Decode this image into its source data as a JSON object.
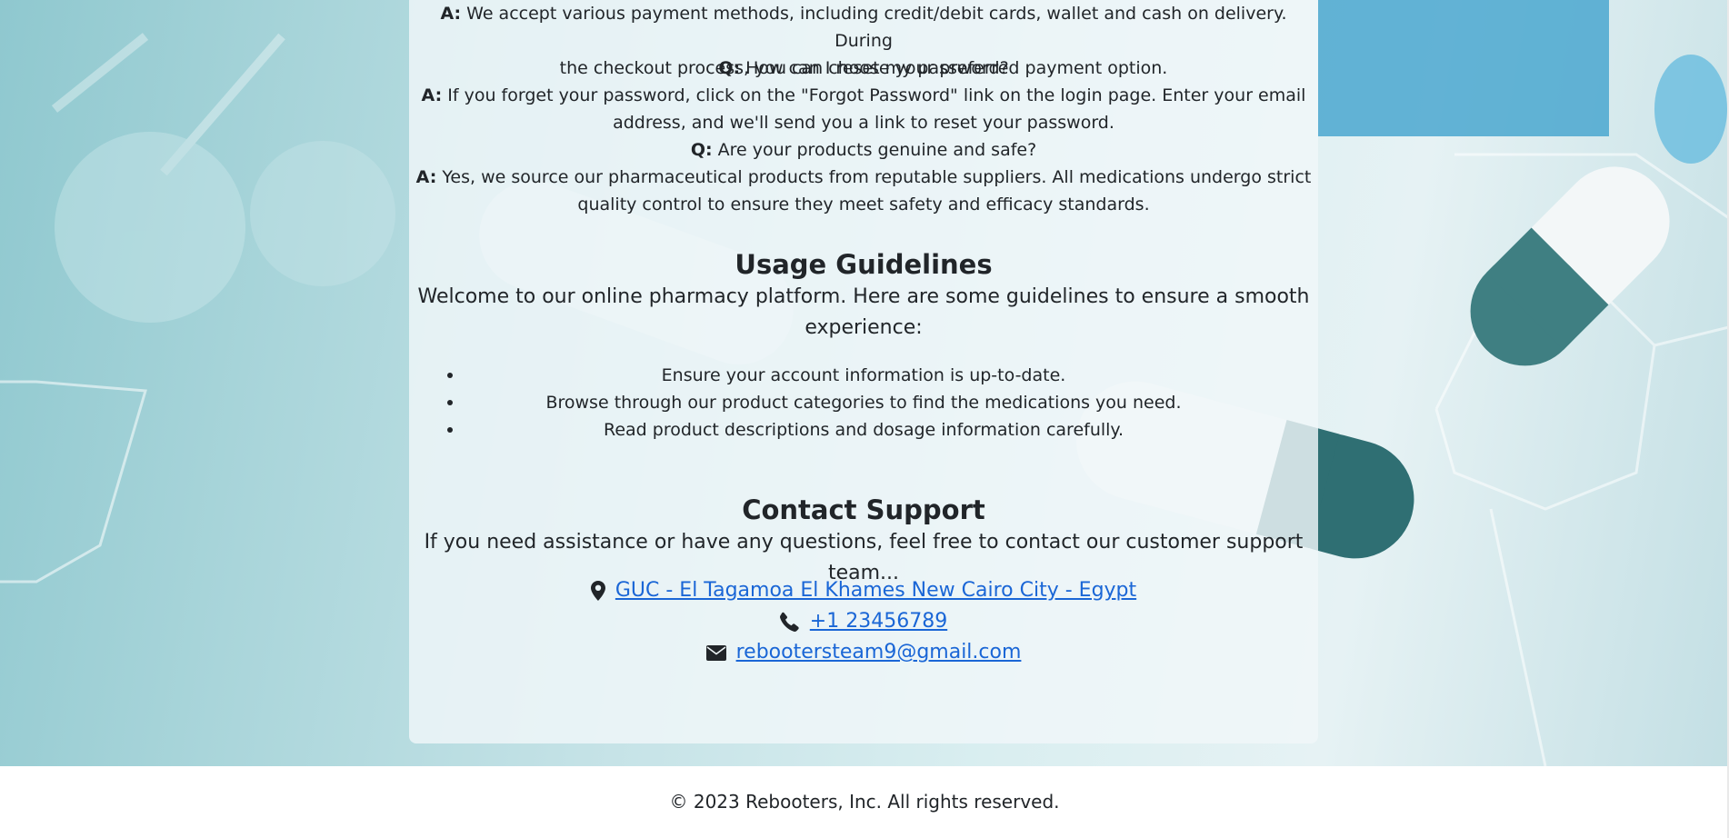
{
  "faq": {
    "a1_prefix": "A:",
    "a1_line1": "We accept various payment methods, including credit/debit cards, wallet and cash on delivery. During",
    "a1_line2": "the checkout process, you can choose your preferred payment option.",
    "q2_prefix": "Q:",
    "q2": "How can I reset my password?",
    "a2_prefix": "A:",
    "a2_line1": "If you forget your password, click on the \"Forgot Password\" link on the login page. Enter your email",
    "a2_line2": "address, and we'll send you a link to reset your password.",
    "q3_prefix": "Q:",
    "q3": "Are your products genuine and safe?",
    "a3_prefix": "A:",
    "a3_line1": "Yes, we source our pharmaceutical products from reputable suppliers. All medications undergo strict",
    "a3_line2": "quality control to ensure they meet safety and efficacy standards."
  },
  "guidelines": {
    "title": "Usage Guidelines",
    "intro_line1": "Welcome to our online pharmacy platform. Here are some guidelines to ensure a smooth",
    "intro_line2": "experience:",
    "items": [
      "Ensure your account information is up-to-date.",
      "Browse through our product categories to find the medications you need.",
      "Read product descriptions and dosage information carefully."
    ]
  },
  "contact": {
    "title": "Contact Support",
    "intro": "If you need assistance or have any questions, feel free to contact our customer support team...",
    "address": "GUC - El Tagamoa El Khames New Cairo City - Egypt",
    "phone": "+1 23456789",
    "email": "rebootersteam9@gmail.com",
    "icons": [
      "map-marker-icon",
      "phone-icon",
      "envelope-icon"
    ],
    "link_color": "#1a66d6"
  },
  "footer": {
    "text": "© 2023 Rebooters, Inc. All rights reserved."
  }
}
